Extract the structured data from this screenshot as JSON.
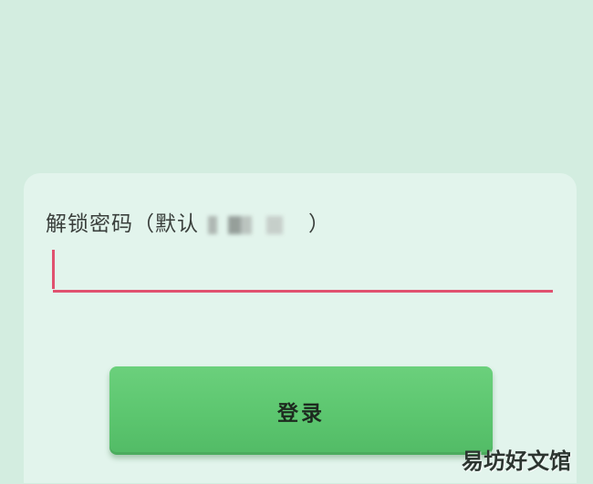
{
  "form": {
    "label_text": "解锁密码（默认",
    "label_close": "）",
    "password_value": "",
    "login_label": "登录"
  },
  "watermark": {
    "main_text": "易坊好文馆"
  },
  "colors": {
    "background": "#d3ede0",
    "card": "#e2f4ec",
    "accent_underline": "#e0516f",
    "button_green": "#5cc66f"
  }
}
